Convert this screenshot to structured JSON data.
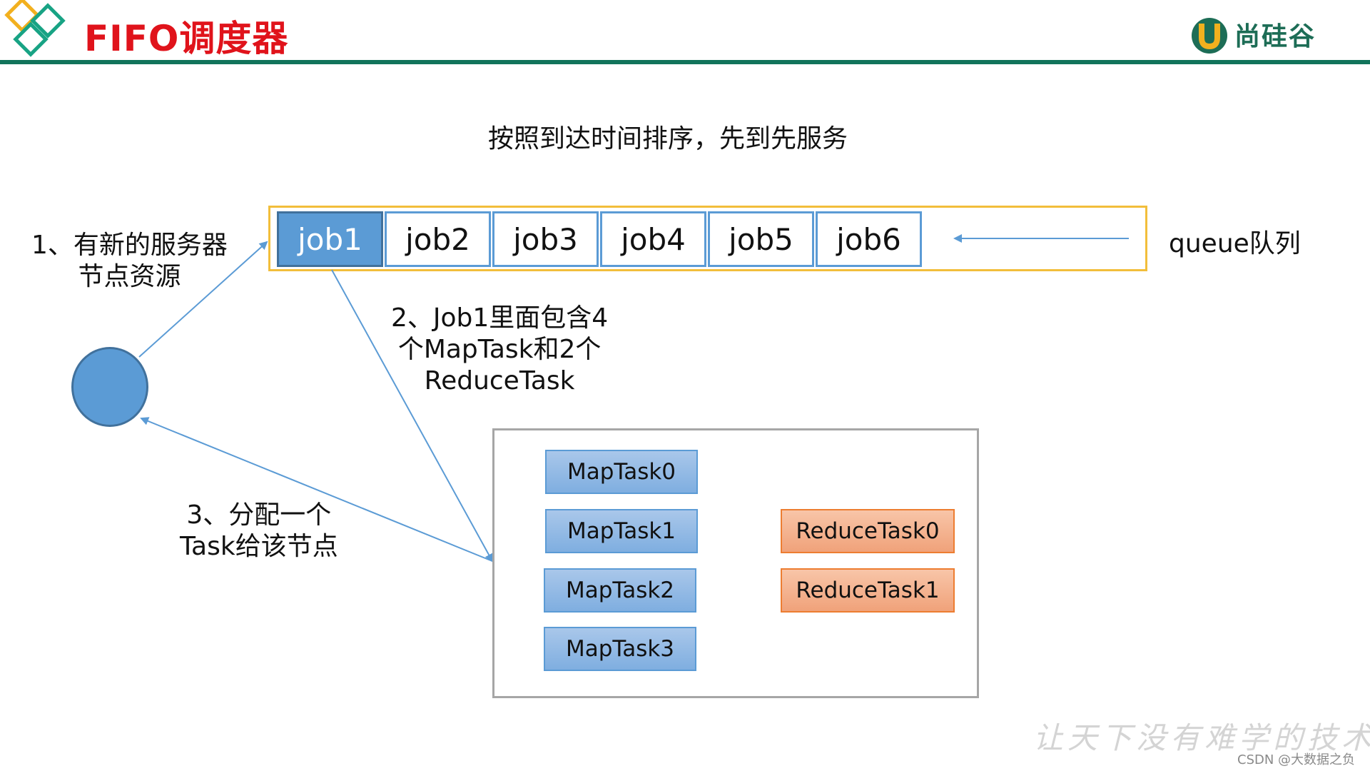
{
  "header": {
    "title": "FIFO调度器",
    "brand": "尚硅谷"
  },
  "subtitle": "按照到达时间排序，先到先服务",
  "queue": {
    "jobs": [
      "job1",
      "job2",
      "job3",
      "job4",
      "job5",
      "job6"
    ],
    "label": "queue队列"
  },
  "notes": {
    "step1": [
      "1、有新的服务器",
      "节点资源"
    ],
    "step2": [
      "2、Job1里面包含4",
      "个MapTask和2个",
      "ReduceTask"
    ],
    "step3": [
      "3、分配一个",
      "Task给该节点"
    ]
  },
  "tasks": {
    "map": [
      "MapTask0",
      "MapTask1",
      "MapTask2",
      "MapTask3"
    ],
    "reduce": [
      "ReduceTask0",
      "ReduceTask1"
    ]
  },
  "footer": {
    "watermark": "让天下没有难学的技术",
    "credit": "CSDN @大数据之负"
  },
  "colors": {
    "title": "#e0131b",
    "header_rule": "#12745b",
    "queue_border": "#f2be3b",
    "job_border": "#5b9bd5",
    "job_active_fill": "#5b9bd5",
    "node_fill": "#5b9bd5",
    "map_task_fill": "#8fb7e4",
    "reduce_task_fill": "#f4b183"
  }
}
